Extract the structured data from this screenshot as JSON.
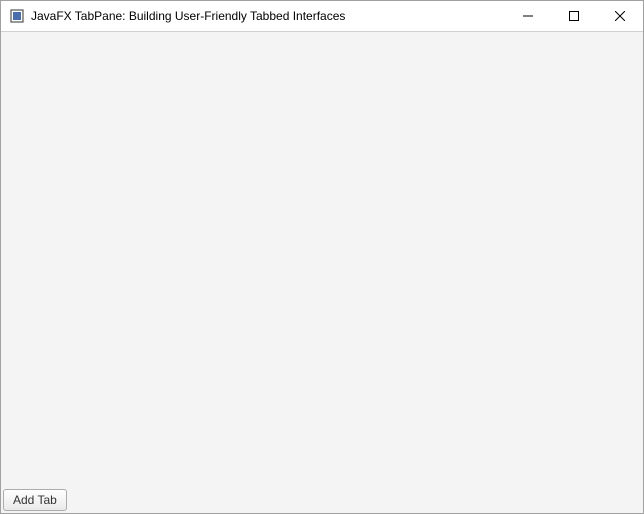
{
  "window": {
    "title": "JavaFX TabPane: Building User-Friendly Tabbed Interfaces"
  },
  "controls": {
    "minimize_name": "minimize",
    "maximize_name": "maximize",
    "close_name": "close"
  },
  "footer": {
    "add_tab_label": "Add Tab"
  },
  "colors": {
    "content_bg": "#f4f4f4",
    "border": "#a0a0a0"
  }
}
